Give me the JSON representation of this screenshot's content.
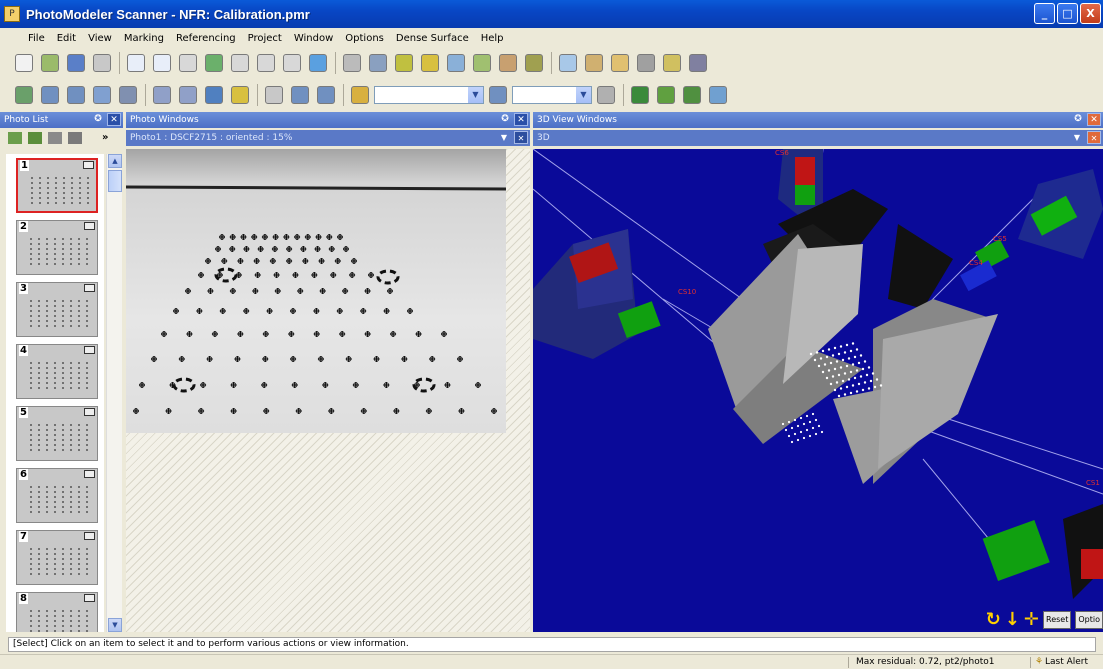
{
  "window": {
    "title": "PhotoModeler Scanner - NFR: Calibration.pmr",
    "controls": [
      "_",
      "□",
      "X"
    ]
  },
  "menu": [
    "File",
    "Edit",
    "View",
    "Marking",
    "Referencing",
    "Project",
    "Window",
    "Options",
    "Dense Surface",
    "Help"
  ],
  "toolbar1": {
    "buttons": [
      {
        "name": "new-icon",
        "color": "#f2f2f2"
      },
      {
        "name": "open-icon",
        "color": "#9bbb6a"
      },
      {
        "name": "save-icon",
        "color": "#5a7fc8"
      },
      {
        "name": "undo-icon",
        "color": "#c8c8c8"
      },
      {
        "name": "select-icon",
        "color": "#e8eef9"
      },
      {
        "name": "select-multi-icon",
        "color": "#e8eef9"
      },
      {
        "name": "delete-icon",
        "color": "#d8d8d8"
      },
      {
        "name": "mark-point-icon",
        "color": "#6bb06b"
      },
      {
        "name": "line-icon",
        "color": "#d8d8d8"
      },
      {
        "name": "curve-icon",
        "color": "#d8d8d8"
      },
      {
        "name": "edge-icon",
        "color": "#d8d8d8"
      },
      {
        "name": "surface-icon",
        "color": "#5aa0e0"
      },
      {
        "name": "pencil-icon",
        "color": "#bbbbbb"
      },
      {
        "name": "reference-icon",
        "color": "#8aa0c0"
      },
      {
        "name": "chain-icon",
        "color": "#c0c040"
      },
      {
        "name": "auto-reference-icon",
        "color": "#d8c040"
      },
      {
        "name": "process-icon",
        "color": "#8ab0d8"
      },
      {
        "name": "wand-icon",
        "color": "#a0c070"
      },
      {
        "name": "table-icon",
        "color": "#c8a070"
      },
      {
        "name": "texture-icon",
        "color": "#a0a050"
      },
      {
        "name": "table2-icon",
        "color": "#a8c8e8"
      },
      {
        "name": "shape-icon",
        "color": "#d0b070"
      },
      {
        "name": "points-icon",
        "color": "#e0c070"
      },
      {
        "name": "lines-icon",
        "color": "#a0a0a0"
      },
      {
        "name": "box-icon",
        "color": "#d0c060"
      },
      {
        "name": "eye-icon",
        "color": "#8080a0"
      }
    ]
  },
  "toolbar2": {
    "buttons": [
      {
        "name": "photo-icon",
        "color": "#6aa06a"
      },
      {
        "name": "zoom-photo-icon",
        "color": "#7090c0"
      },
      {
        "name": "image-icon",
        "color": "#7090c0"
      },
      {
        "name": "camera-icon",
        "color": "#80a0d0"
      },
      {
        "name": "info-icon",
        "color": "#8090b0"
      },
      {
        "name": "window-icon",
        "color": "#90a0c8"
      },
      {
        "name": "window2-icon",
        "color": "#90a0c8"
      },
      {
        "name": "view-icon",
        "color": "#5080c0"
      },
      {
        "name": "ruler-icon",
        "color": "#d8c040"
      },
      {
        "name": "zoom-icon",
        "color": "#c8c8c8"
      },
      {
        "name": "fit-icon",
        "color": "#7090c0"
      },
      {
        "name": "grid-icon",
        "color": "#7090c0"
      },
      {
        "name": "label-icon",
        "color": "#d8b040"
      },
      {
        "name": "ortho-icon",
        "color": "#7090c0"
      },
      {
        "name": "palette-icon",
        "color": "#b0b0b0"
      },
      {
        "name": "dots-icon",
        "color": "#3a8a3a"
      },
      {
        "name": "pair-icon",
        "color": "#60a040"
      },
      {
        "name": "link-icon",
        "color": "#509040"
      },
      {
        "name": "diamond-icon",
        "color": "#70a0d0"
      }
    ],
    "combo1": "",
    "combo2": ""
  },
  "panes": {
    "photo_list": {
      "title": "Photo List",
      "thumbs": [
        "1",
        "2",
        "3",
        "4",
        "5",
        "6",
        "7",
        "8"
      ]
    },
    "photo_windows": {
      "title": "Photo Windows",
      "subtitle": "Photo1 : DSCF2715 : oriented : 15%"
    },
    "view3d": {
      "title": "3D View Windows",
      "subtitle": "3D"
    }
  },
  "scene_labels": [
    "CS6",
    "CS5",
    "CS4",
    "CS10",
    "CS1"
  ],
  "view_controls": {
    "reset": "Reset",
    "options": "Optio"
  },
  "status": {
    "hint": "[Select] Click on an item to select it and to perform various actions or view information.",
    "residual": "Max residual: 0.72, pt2/photo1",
    "alert": "Last Alert"
  }
}
